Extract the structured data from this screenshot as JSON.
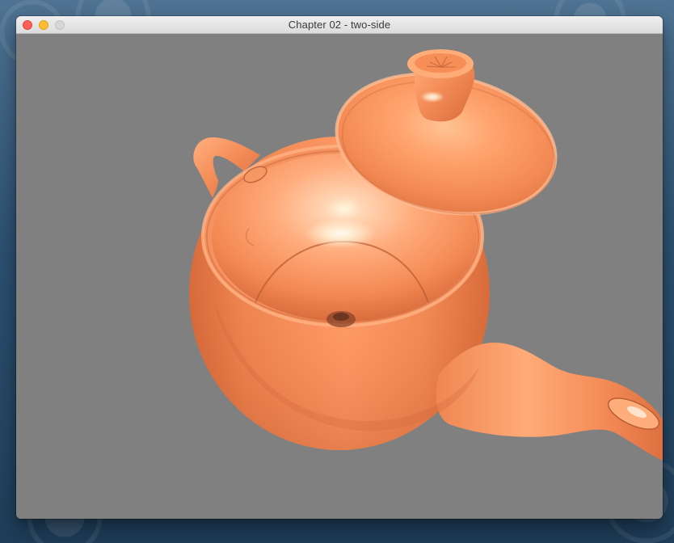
{
  "window": {
    "title": "Chapter 02 - two-side"
  },
  "colors": {
    "viewport_background": "#808080",
    "teapot_orange": "#f48a55",
    "teapot_shadow": "#d9693a",
    "highlight": "#fff0d9"
  },
  "scene": {
    "object": "teapot",
    "parts": [
      "body",
      "handle",
      "spout",
      "lid",
      "lid-knob",
      "inner-cavity"
    ]
  }
}
